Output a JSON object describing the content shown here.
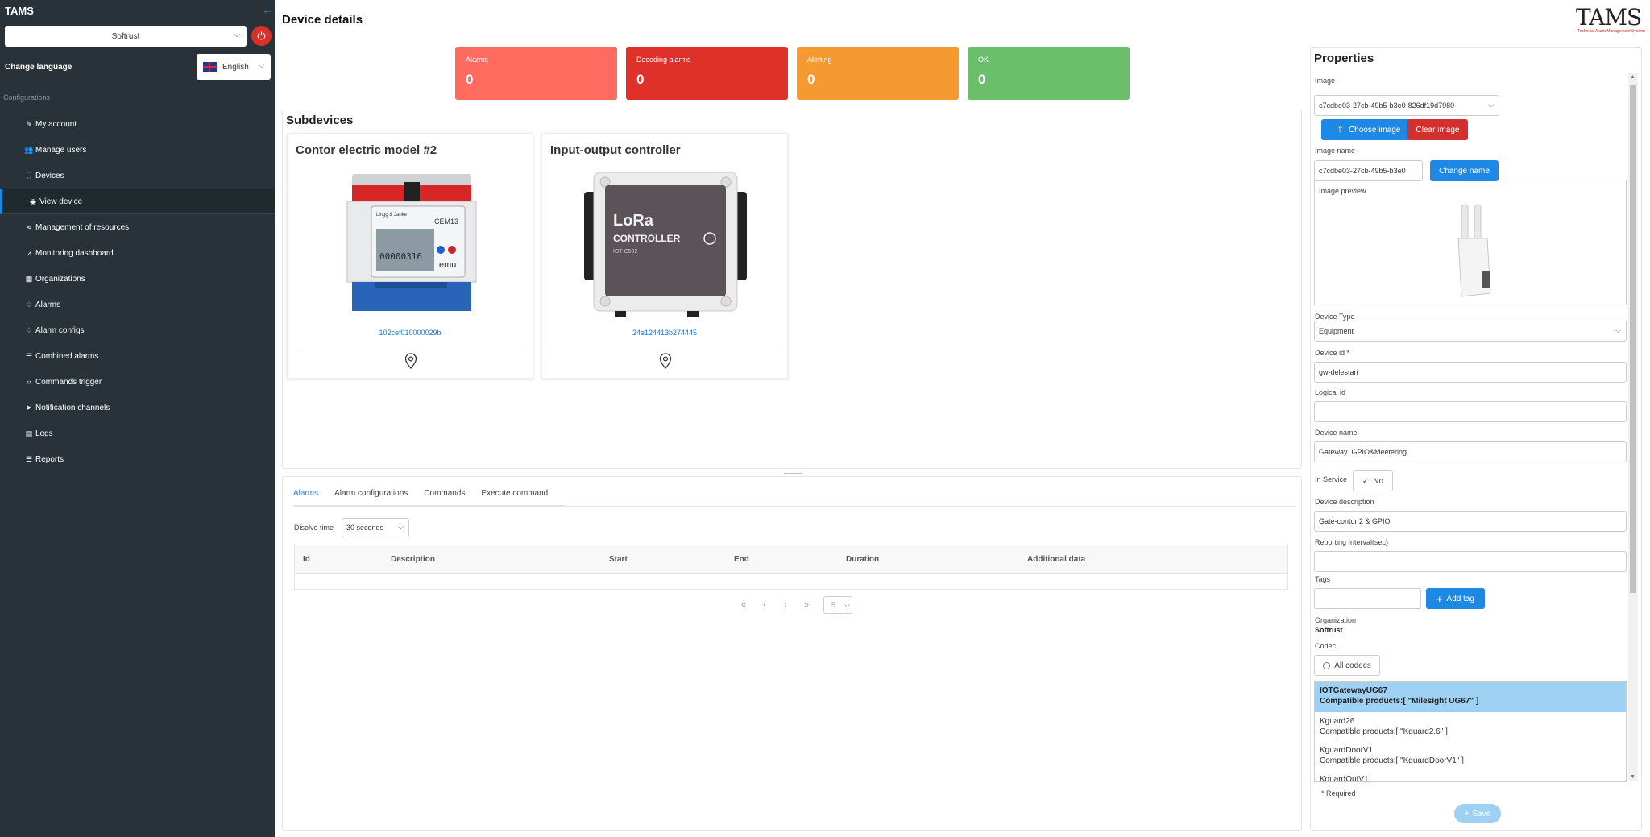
{
  "sidebar": {
    "title": "TAMS",
    "org_select": "Softrust",
    "change_language_label": "Change language",
    "language": "English",
    "section": "Configurations",
    "items": [
      {
        "label": "My account",
        "icon": "user-edit-icon",
        "glyph": "✎"
      },
      {
        "label": "Manage users",
        "icon": "users-icon",
        "glyph": "👥"
      },
      {
        "label": "Devices",
        "icon": "devices-icon",
        "glyph": "⛶"
      },
      {
        "label": "View device",
        "icon": "eye-icon",
        "glyph": "◉"
      },
      {
        "label": "Management of resources",
        "icon": "share-icon",
        "glyph": "⋖"
      },
      {
        "label": "Monitoring dashboard",
        "icon": "chart-line-icon",
        "glyph": "⩘"
      },
      {
        "label": "Organizations",
        "icon": "grid-icon",
        "glyph": "▦"
      },
      {
        "label": "Alarms",
        "icon": "bell-icon",
        "glyph": "♢"
      },
      {
        "label": "Alarm configs",
        "icon": "bell-config-icon",
        "glyph": "♢"
      },
      {
        "label": "Combined alarms",
        "icon": "list-icon",
        "glyph": "☰"
      },
      {
        "label": "Commands trigger",
        "icon": "code-icon",
        "glyph": "‹›"
      },
      {
        "label": "Notification channels",
        "icon": "send-icon",
        "glyph": "➤"
      },
      {
        "label": "Logs",
        "icon": "book-icon",
        "glyph": "▤"
      },
      {
        "label": "Reports",
        "icon": "bars-icon",
        "glyph": "☰"
      }
    ]
  },
  "page": {
    "title": "Device details",
    "logo_text": "TAMS",
    "logo_sub": "Technical Alarm Management System"
  },
  "stats": [
    {
      "label": "Alarms",
      "value": "0",
      "color": "#ff6b5e"
    },
    {
      "label": "Decoding alarms",
      "value": "0",
      "color": "#df3129"
    },
    {
      "label": "Alerting",
      "value": "0",
      "color": "#f49a31"
    },
    {
      "label": "OK",
      "value": "0",
      "color": "#6bbf6b"
    }
  ],
  "subdevices": {
    "title": "Subdevices",
    "cards": [
      {
        "name": "Contor electric model #2",
        "id": "102cef010000029b",
        "meter_brand": "Lingg & Janke",
        "meter_model": "CEM13",
        "meter_reading": "00000316",
        "meter_logo": "emu"
      },
      {
        "name": "Input-output controller",
        "id": "24e124413b274445",
        "box_title": "LoRa",
        "box_subtitle": "CONTROLLER",
        "box_model": "IOT-C502"
      }
    ]
  },
  "bottom": {
    "tabs": [
      "Alarms",
      "Alarm configurations",
      "Commands",
      "Execute command"
    ],
    "dissolve_label": "Disolve time",
    "dissolve_value": "30 seconds",
    "columns": [
      "Id",
      "Description",
      "Start",
      "End",
      "Duration",
      "Additional data"
    ],
    "pager": {
      "first": "«",
      "prev": "‹",
      "next": "›",
      "last": "»",
      "page_size": "5"
    }
  },
  "properties": {
    "title": "Properties",
    "image_label": "Image",
    "image_value": "c7cdbe03-27cb-49b5-b3e0-826df19d7980",
    "choose_image": "Choose image",
    "clear_image": "Clear image",
    "image_name_label": "Image name",
    "image_name_value": "c7cdbe03-27cb-49b5-b3e0",
    "change_name": "Change name",
    "image_preview_label": "Image preview",
    "device_type_label": "Device Type",
    "device_type_value": "Equipment",
    "device_id_label": "Device id *",
    "device_id_value": "gw-delestari",
    "logical_id_label": "Logical id",
    "logical_id_value": "",
    "device_name_label": "Device name",
    "device_name_value": "Gateway .GPIO&Meetering",
    "in_service_label": "In Service",
    "in_service_value": "No",
    "device_desc_label": "Device description",
    "device_desc_value": "Gate-contor 2 & GPIO",
    "reporting_label": "Reporting Interval(sec)",
    "reporting_value": "",
    "tags_label": "Tags",
    "add_tag": "Add tag",
    "organization_label": "Organization",
    "organization_value": "Softrust",
    "codec_label": "Codec",
    "all_codecs": "All codecs",
    "codecs": [
      {
        "name": "IOTGatewayUG67",
        "compat": "Compatible products:[ \"Milesight UG67\" ]"
      },
      {
        "name": "Kguard26",
        "compat": "Compatible products:[ \"Kguard2.6\" ]"
      },
      {
        "name": "KguardDoorV1",
        "compat": "Compatible products:[ \"KguardDoorV1\" ]"
      },
      {
        "name": "KguardOutV1",
        "compat": ""
      }
    ],
    "required_note": "* Required",
    "save": "Save"
  }
}
